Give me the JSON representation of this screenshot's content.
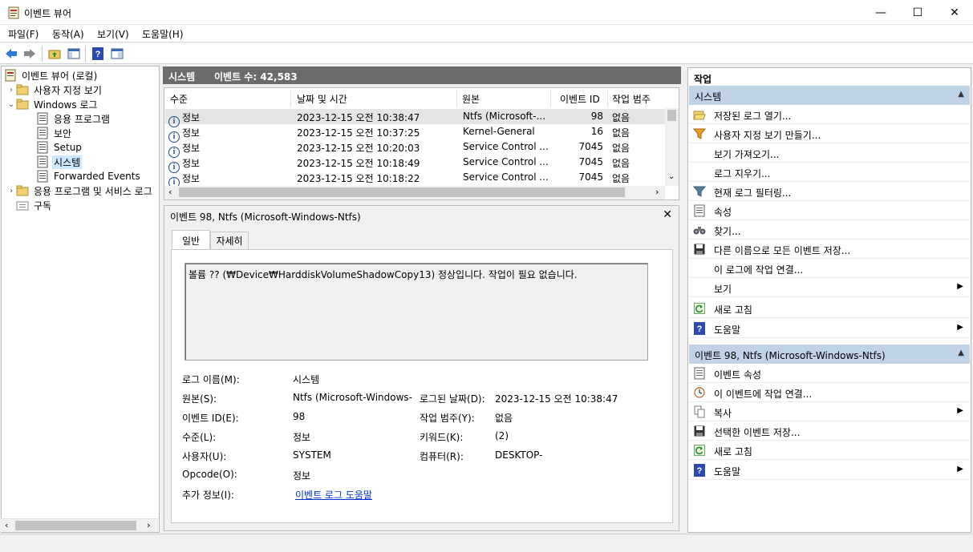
{
  "window": {
    "title": "이벤트 뷰어",
    "minimize": "—",
    "maximize": "☐",
    "close": "✕"
  },
  "menu": [
    "파일(F)",
    "동작(A)",
    "보기(V)",
    "도움말(H)"
  ],
  "tree": {
    "root": "이벤트 뷰어 (로컬)",
    "custom_views": "사용자 지정 보기",
    "windows_logs": "Windows 로그",
    "application": "응용 프로그램",
    "security": "보안",
    "setup": "Setup",
    "system": "시스템",
    "forwarded": "Forwarded Events",
    "apps_services": "응용 프로그램 및 서비스 로그",
    "subscriptions": "구독"
  },
  "center": {
    "log_name": "시스템",
    "event_count": "이벤트 수: 42,583",
    "columns": [
      "수준",
      "날짜 및 시간",
      "원본",
      "이벤트 ID",
      "작업 범주"
    ],
    "rows": [
      {
        "level": "정보",
        "datetime": "2023-12-15 오전 10:38:47",
        "source": "Ntfs (Microsoft-...",
        "id": "98",
        "category": "없음"
      },
      {
        "level": "정보",
        "datetime": "2023-12-15 오전 10:37:25",
        "source": "Kernel-General",
        "id": "16",
        "category": "없음"
      },
      {
        "level": "정보",
        "datetime": "2023-12-15 오전 10:20:03",
        "source": "Service Control ...",
        "id": "7045",
        "category": "없음"
      },
      {
        "level": "정보",
        "datetime": "2023-12-15 오전 10:18:49",
        "source": "Service Control ...",
        "id": "7045",
        "category": "없음"
      },
      {
        "level": "정보",
        "datetime": "2023-12-15 오전 10:18:22",
        "source": "Service Control ...",
        "id": "7045",
        "category": "없음"
      }
    ]
  },
  "detail": {
    "title": "이벤트 98, Ntfs (Microsoft-Windows-Ntfs)",
    "tabs": [
      "일반",
      "자세히"
    ],
    "message": "볼륨 ?? (₩Device₩HarddiskVolumeShadowCopy13) 정상입니다. 작업이 필요 없습니다.",
    "fields": {
      "log_name_label": "로그 이름(M):",
      "log_name_value": "시스템",
      "source_label": "원본(S):",
      "source_value": "Ntfs (Microsoft-Windows-N",
      "logged_label": "로그된 날짜(D):",
      "logged_value": "2023-12-15 오전 10:38:47",
      "event_id_label": "이벤트 ID(E):",
      "event_id_value": "98",
      "task_label": "작업 범주(Y):",
      "task_value": "없음",
      "level_label": "수준(L):",
      "level_value": "정보",
      "keywords_label": "키워드(K):",
      "keywords_value": "(2)",
      "user_label": "사용자(U):",
      "user_value": "SYSTEM",
      "computer_label": "컴퓨터(R):",
      "computer_value": "DESKTOP-",
      "opcode_label": "Opcode(O):",
      "opcode_value": "정보",
      "more_label": "추가 정보(I):",
      "more_link": "이벤트 로그 도움말"
    }
  },
  "actions": {
    "header": "작업",
    "section1": "시스템",
    "items1": [
      "저장된 로그 열기...",
      "사용자 지정 보기 만들기...",
      "보기 가져오기...",
      "로그 지우기...",
      "현재 로그 필터링...",
      "속성",
      "찾기...",
      "다른 이름으로 모든 이벤트 저장...",
      "이 로그에 작업 연결...",
      "보기",
      "새로 고침",
      "도움말"
    ],
    "section2": "이벤트 98, Ntfs (Microsoft-Windows-Ntfs)",
    "items2": [
      "이벤트 속성",
      "이 이벤트에 작업 연결...",
      "복사",
      "선택한 이벤트 저장...",
      "새로 고침",
      "도움말"
    ]
  }
}
